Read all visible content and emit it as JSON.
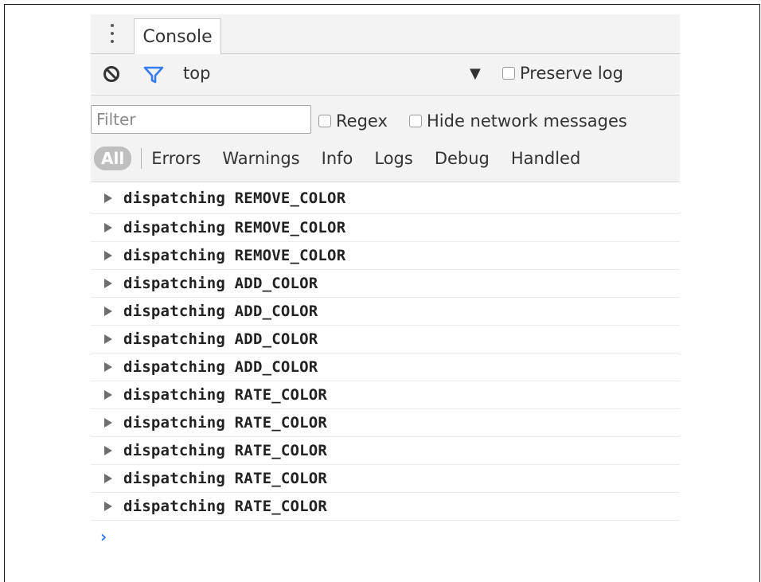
{
  "tabs": [
    {
      "label": "Console"
    }
  ],
  "toolbar": {
    "context": "top",
    "preserve_log_label": "Preserve log"
  },
  "filter": {
    "placeholder": "Filter",
    "regex_label": "Regex",
    "hide_network_label": "Hide network messages"
  },
  "levels": [
    "All",
    "Errors",
    "Warnings",
    "Info",
    "Logs",
    "Debug",
    "Handled"
  ],
  "messages": [
    "dispatching REMOVE_COLOR",
    "dispatching REMOVE_COLOR",
    "dispatching REMOVE_COLOR",
    "dispatching ADD_COLOR",
    "dispatching ADD_COLOR",
    "dispatching ADD_COLOR",
    "dispatching ADD_COLOR",
    "dispatching RATE_COLOR",
    "dispatching RATE_COLOR",
    "dispatching RATE_COLOR",
    "dispatching RATE_COLOR",
    "dispatching RATE_COLOR"
  ],
  "prompt": "›",
  "colors": {
    "accent": "#367cf1",
    "toolbar_bg": "#f3f3f3"
  }
}
